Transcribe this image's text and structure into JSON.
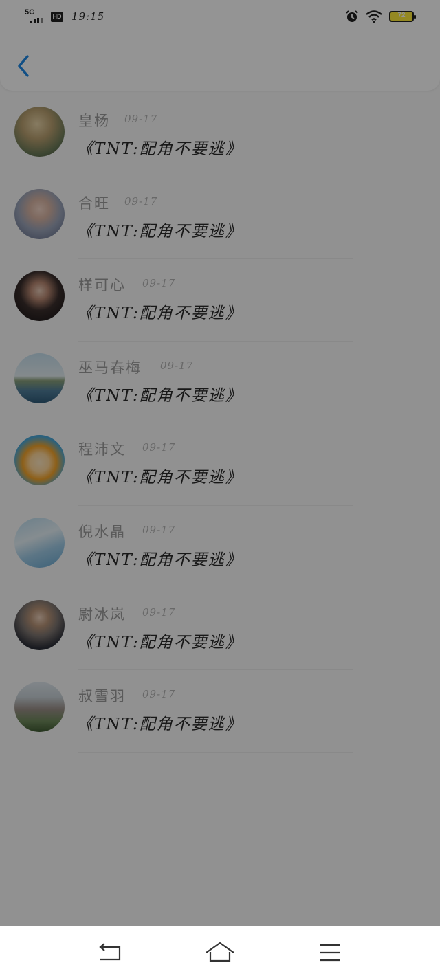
{
  "status_bar": {
    "network": "5G",
    "hd": "HD",
    "time": "19:15",
    "battery": "72"
  },
  "nav": {
    "back_icon": "chevron-left-icon",
    "accent": "#1e88e5"
  },
  "messages": [
    {
      "name": "皇杨",
      "date": "09-17",
      "text": "《TNT:配角不要逃》"
    },
    {
      "name": "合旺",
      "date": "09-17",
      "text": "《TNT:配角不要逃》"
    },
    {
      "name": "样可心",
      "date": "09-17",
      "text": "《TNT:配角不要逃》"
    },
    {
      "name": "巫马春梅",
      "date": "09-17",
      "text": "《TNT:配角不要逃》"
    },
    {
      "name": "程沛文",
      "date": "09-17",
      "text": "《TNT:配角不要逃》"
    },
    {
      "name": "倪水晶",
      "date": "09-17",
      "text": "《TNT:配角不要逃》"
    },
    {
      "name": "尉冰岚",
      "date": "09-17",
      "text": "《TNT:配角不要逃》"
    },
    {
      "name": "叔雪羽",
      "date": "09-17",
      "text": "《TNT:配角不要逃》"
    }
  ],
  "system_nav": {
    "back": "back-arrow-icon",
    "home": "home-icon",
    "menu": "menu-icon"
  }
}
